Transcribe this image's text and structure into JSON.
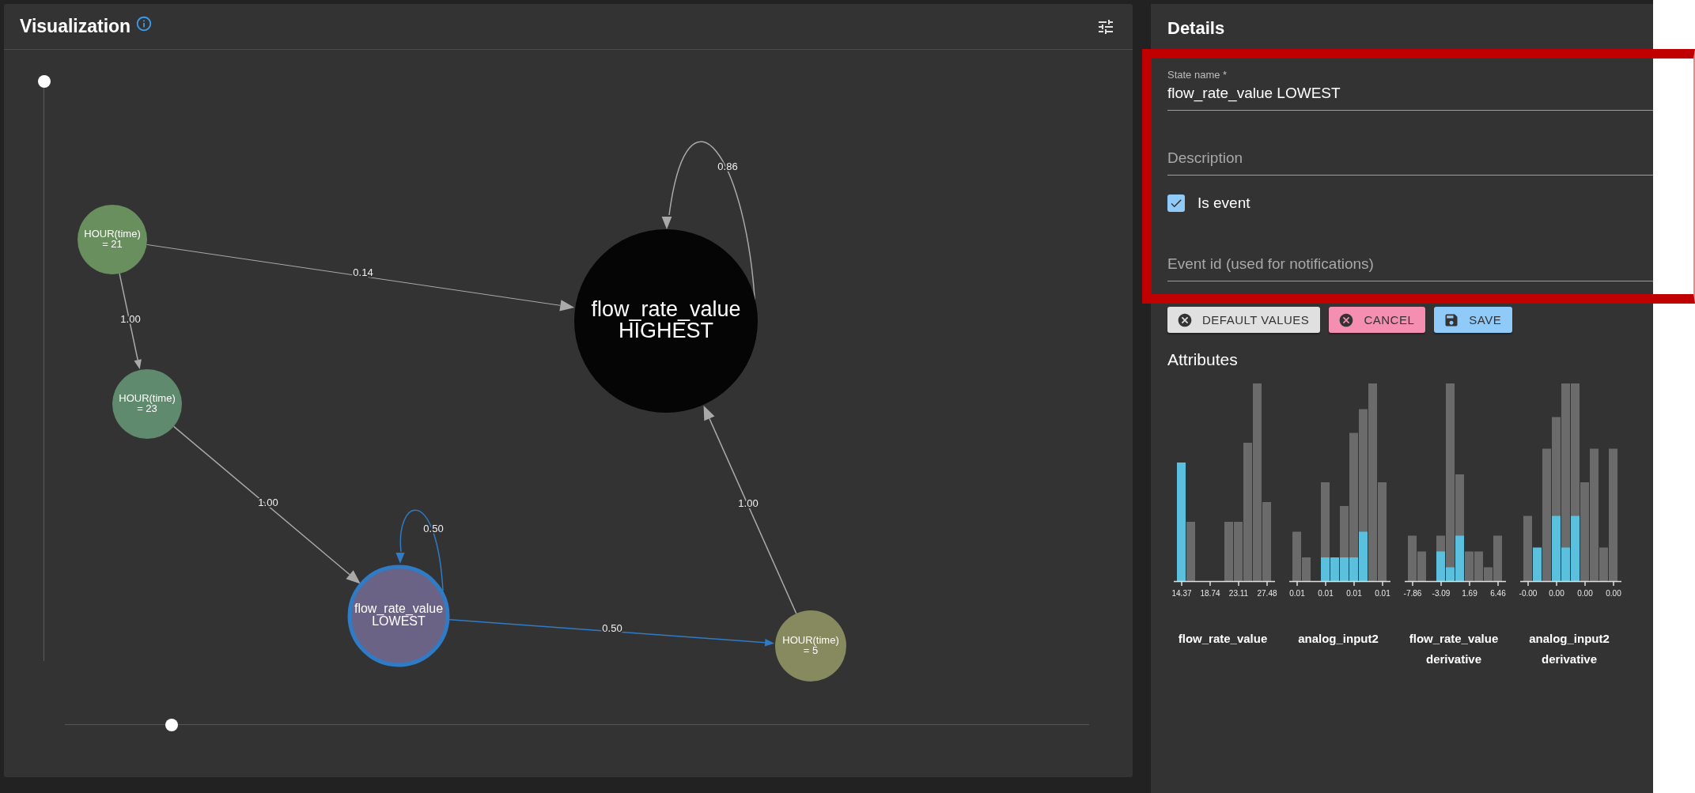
{
  "visualization": {
    "title": "Visualization",
    "vertical_slider": {
      "level": 1
    },
    "horizontal_slider": {
      "level": 0.1
    },
    "nodes": [
      {
        "lines": [
          "HOUR(time)",
          "= 21"
        ],
        "color": "#6a8f5f",
        "selected": false
      },
      {
        "lines": [
          "HOUR(time)",
          "= 23"
        ],
        "color": "#5f8a6e",
        "selected": false
      },
      {
        "lines": [
          "flow_rate_value",
          "HIGHEST"
        ],
        "color": "#050505",
        "selected": false
      },
      {
        "lines": [
          "flow_rate_value",
          "LOWEST"
        ],
        "color": "#6a6386",
        "selected": true
      },
      {
        "lines": [
          "HOUR(time)",
          "= 5"
        ],
        "color": "#868a5e",
        "selected": false
      }
    ],
    "edges": [
      {
        "label": "0.14",
        "highlighted": false
      },
      {
        "label": "1.00",
        "highlighted": false
      },
      {
        "label": "0.86",
        "highlighted": false
      },
      {
        "label": "1.00",
        "highlighted": false
      },
      {
        "label": "0.50",
        "highlighted": true
      },
      {
        "label": "0.50",
        "highlighted": true
      },
      {
        "label": "1.00",
        "highlighted": false
      }
    ]
  },
  "details": {
    "title": "Details",
    "state_name": {
      "label": "State name *",
      "value": "flow_rate_value LOWEST"
    },
    "description": {
      "placeholder": "Description"
    },
    "is_event": {
      "label": "Is event",
      "checked": true
    },
    "event_id": {
      "placeholder": "Event id (used for notifications)"
    },
    "buttons": [
      {
        "label": "DEFAULT VALUES",
        "kind": "default"
      },
      {
        "label": "CANCEL",
        "kind": "cancel"
      },
      {
        "label": "SAVE",
        "kind": "save"
      }
    ],
    "attributes_title": "Attributes",
    "attributes": [
      {
        "name": [
          "flow_rate_value"
        ],
        "ticks": [
          "14.37",
          "18.74",
          "23.11",
          "27.48"
        ]
      },
      {
        "name": [
          "analog_input2"
        ],
        "ticks": [
          "0.01",
          "0.01",
          "0.01",
          "0.01"
        ]
      },
      {
        "name": [
          "flow_rate_value",
          "derivative"
        ],
        "ticks": [
          "-7.86",
          "-3.09",
          "1.69",
          "6.46"
        ]
      },
      {
        "name": [
          "analog_input2",
          "derivative"
        ],
        "ticks": [
          "-0.00",
          "0.00",
          "0.00",
          "0.00"
        ]
      }
    ]
  }
}
